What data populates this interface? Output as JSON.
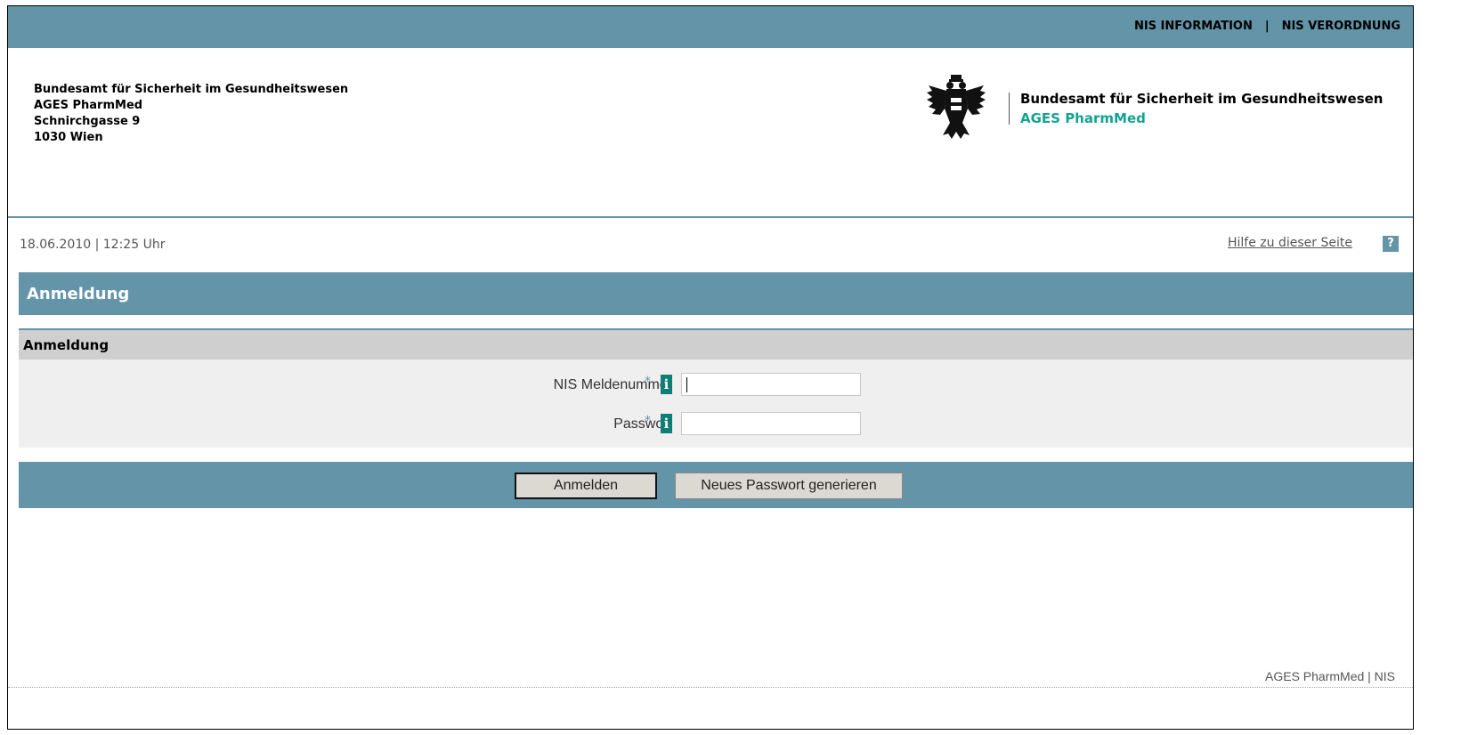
{
  "topnav": {
    "info": "NIS INFORMATION",
    "separator": "|",
    "verordnung": "NIS VERORDNUNG"
  },
  "address": {
    "line1": "Bundesamt für Sicherheit im Gesundheitswesen",
    "line2": "AGES PharmMed",
    "line3": "Schnirchgasse 9",
    "line4": "1030 Wien"
  },
  "logo": {
    "icon": "austrian-eagle-emblem",
    "line1": "Bundesamt für Sicherheit im Gesundheitswesen",
    "line2": "AGES PharmMed",
    "accent_color": "#14a390"
  },
  "status": {
    "datetime": "18.06.2010 | 12:25 Uhr",
    "help_link": "Hilfe zu dieser Seite",
    "help_icon": "?"
  },
  "page": {
    "title": "Anmeldung",
    "section_title": "Anmeldung"
  },
  "form": {
    "fields": [
      {
        "label": "NIS Meldenummer",
        "required": "*",
        "info": "i",
        "value": ""
      },
      {
        "label": "Passwort",
        "required": "*",
        "info": "i",
        "value": ""
      }
    ]
  },
  "buttons": {
    "login": "Anmelden",
    "new_password": "Neues Passwort generieren"
  },
  "footer": {
    "text": "AGES PharmMed | NIS"
  },
  "colors": {
    "brand": "#6394a7",
    "info_icon": "#0f7f76",
    "section_bg": "#efefef",
    "section_head_bg": "#cfcfcf"
  }
}
